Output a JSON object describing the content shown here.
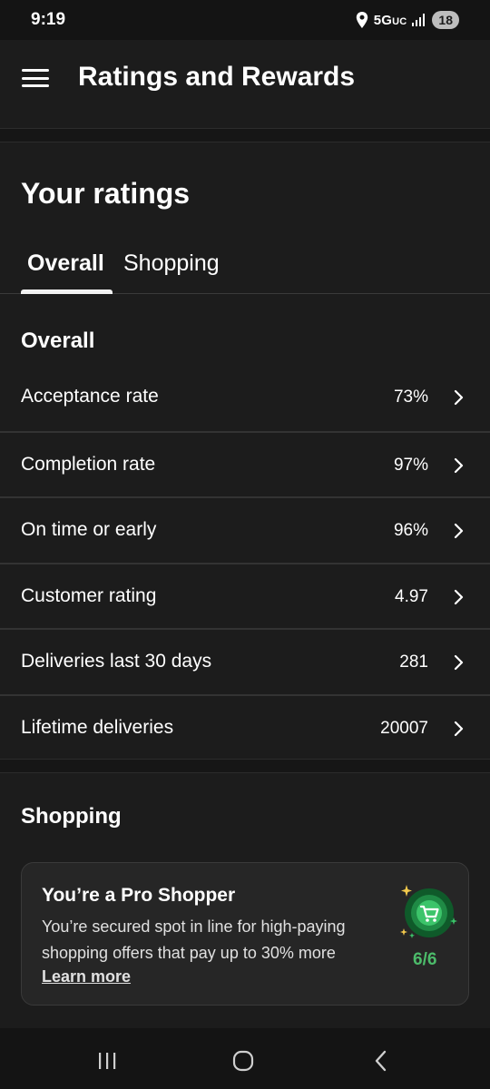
{
  "status_bar": {
    "time": "9:19",
    "network": "5G",
    "network_suffix": "UC",
    "battery": "18"
  },
  "app_bar": {
    "title": "Ratings and Rewards",
    "menu_icon": "hamburger-menu-icon"
  },
  "ratings": {
    "heading": "Your ratings",
    "tabs": [
      {
        "label": "Overall",
        "selected": true
      },
      {
        "label": "Shopping",
        "selected": false
      }
    ],
    "overall_heading": "Overall",
    "metrics": [
      {
        "label": "Acceptance rate",
        "value": "73%"
      },
      {
        "label": "Completion rate",
        "value": "97%"
      },
      {
        "label": "On time or early",
        "value": "96%"
      },
      {
        "label": "Customer rating",
        "value": "4.97"
      },
      {
        "label": "Deliveries last 30 days",
        "value": "281"
      },
      {
        "label": "Lifetime deliveries",
        "value": "20007"
      }
    ]
  },
  "shopping": {
    "heading": "Shopping",
    "card": {
      "title": "You’re a Pro Shopper",
      "description": "You’re secured spot in line for high-paying shopping offers that pay up to 30% more",
      "link": "Learn more",
      "progress": "6/6",
      "badge_icon": "shopping-cart-badge-icon",
      "accent_color": "#4cbb6a"
    }
  },
  "nav_bar": {
    "icons": [
      "recent-apps-icon",
      "home-icon",
      "back-icon"
    ]
  }
}
